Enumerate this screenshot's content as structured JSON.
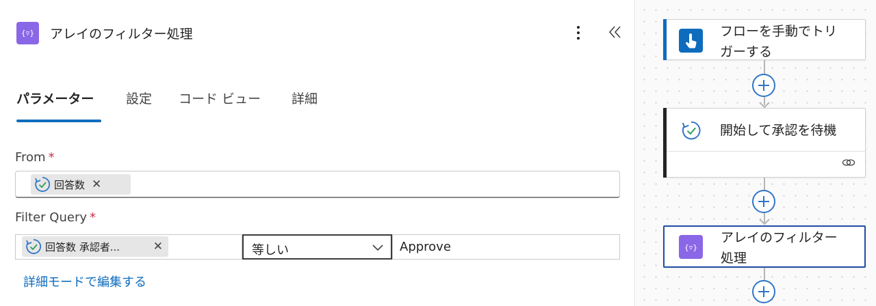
{
  "panel": {
    "title": "アレイのフィルター処理",
    "icon": "filter-array-icon",
    "accent_color": "#8a67e6"
  },
  "tabs": [
    {
      "label": "パラメーター",
      "active": true
    },
    {
      "label": "設定",
      "active": false
    },
    {
      "label": "コード ビュー",
      "active": false
    },
    {
      "label": "詳細",
      "active": false
    }
  ],
  "fields": {
    "from": {
      "label": "From",
      "required_mark": "*",
      "token": "回答数"
    },
    "filter_query": {
      "label": "Filter Query",
      "required_mark": "*",
      "left_token": "回答数 承認者...",
      "operator": "等しい",
      "right_value": "Approve"
    }
  },
  "advanced_link": "詳細モードで編集する",
  "flow": {
    "cards": [
      {
        "title_line1": "フローを手動でトリ",
        "title_line2": "ガーする",
        "accent": "#0f6cbd",
        "icon": "manual-trigger-icon"
      },
      {
        "title_line1": "開始して承認を待機",
        "accent": "#242424",
        "icon": "approval-icon"
      },
      {
        "title_line1": "アレイのフィルター",
        "title_line2": "処理",
        "accent": "#8a67e6",
        "icon": "filter-array-icon",
        "selected": true
      }
    ]
  },
  "colors": {
    "link": "#0f6cbd",
    "tab_underline": "#0f6cbd",
    "required": "#c4314b"
  }
}
